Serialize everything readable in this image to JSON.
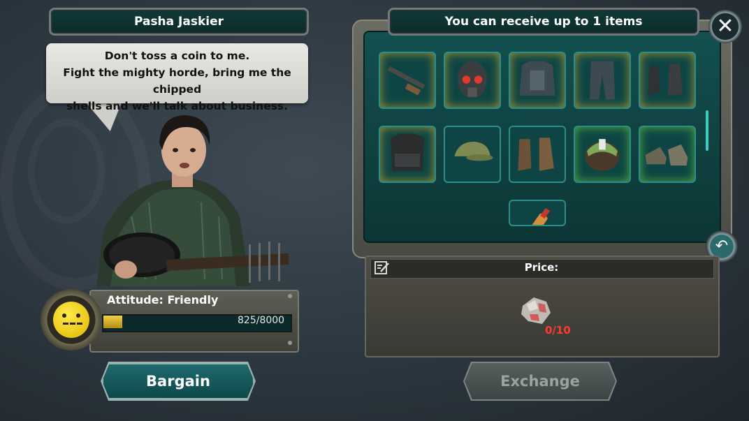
{
  "npc": {
    "name": "Pasha Jaskier",
    "dialogue": [
      "Don't toss a coin to me.",
      "Fight the mighty horde, bring me the chipped",
      "shells and we'll talk about business."
    ]
  },
  "attitude": {
    "label": "Attitude: Friendly",
    "value_text": "825/8000",
    "progress": 0.103,
    "mood_icon": "neutral-face-icon"
  },
  "items_panel": {
    "title": "You can receive up to 1 items",
    "items": [
      {
        "name": "shotgun-icon",
        "rarity": "gold"
      },
      {
        "name": "gas-mask-helmet-icon",
        "rarity": "gold"
      },
      {
        "name": "armored-jacket-icon",
        "rarity": "gold"
      },
      {
        "name": "armored-pants-icon",
        "rarity": "gold"
      },
      {
        "name": "combat-boots-icon",
        "rarity": "gold"
      },
      {
        "name": "tactical-vest-icon",
        "rarity": "gold"
      },
      {
        "name": "camo-cap-icon",
        "rarity": "none"
      },
      {
        "name": "leather-boots-icon",
        "rarity": "none"
      },
      {
        "name": "bandana-icon",
        "rarity": "green"
      },
      {
        "name": "sneakers-icon",
        "rarity": "green"
      },
      {
        "name": "bottle-icon",
        "rarity": "none"
      }
    ]
  },
  "price": {
    "label": "Price:",
    "item_icon": "chipped-shell-icon",
    "count_text": "0/10"
  },
  "buttons": {
    "bargain": "Bargain",
    "exchange": "Exchange",
    "close_icon": "close-icon",
    "back_icon": "back-arrow-icon"
  },
  "colors": {
    "panel_teal": "#0e4544",
    "slot_border": "#2c8e8a",
    "gold_glow": "#ffc828",
    "green_glow": "#78f03c",
    "price_red": "#ff3a2a"
  }
}
